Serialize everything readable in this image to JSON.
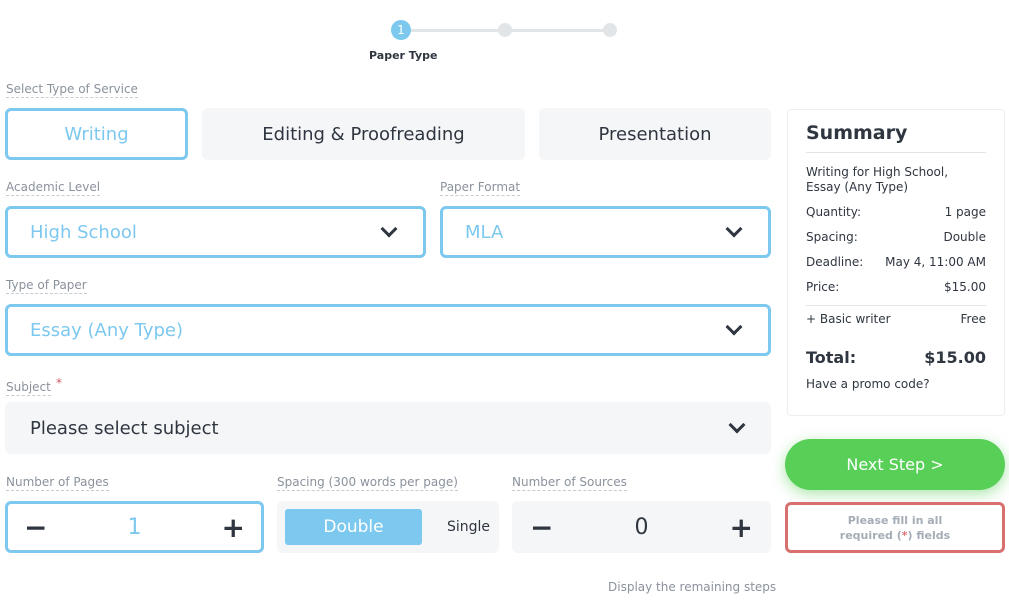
{
  "stepper": {
    "current": "1",
    "label": "Paper Type",
    "steps": 3
  },
  "service": {
    "label": "Select Type of Service",
    "options": [
      "Writing",
      "Editing & Proofreading",
      "Presentation"
    ],
    "selected": "Writing"
  },
  "academic_level": {
    "label": "Academic Level",
    "value": "High School"
  },
  "paper_format": {
    "label": "Paper Format",
    "value": "MLA"
  },
  "paper_type": {
    "label": "Type of Paper",
    "value": "Essay (Any Type)"
  },
  "subject": {
    "label": "Subject",
    "required": "*",
    "placeholder": "Please select subject"
  },
  "pages": {
    "label": "Number of Pages",
    "value": "1",
    "minus": "−",
    "plus": "+"
  },
  "spacing": {
    "label": "Spacing (300 words per page)",
    "options": [
      "Double",
      "Single"
    ],
    "selected": "Double"
  },
  "sources": {
    "label": "Number of Sources",
    "value": "0",
    "minus": "−",
    "plus": "+"
  },
  "summary": {
    "title": "Summary",
    "description": "Writing for High School, Essay (Any Type)",
    "rows": [
      {
        "k": "Quantity:",
        "v": "1 page"
      },
      {
        "k": "Spacing:",
        "v": "Double"
      },
      {
        "k": "Deadline:",
        "v": "May 4, 11:00 AM"
      },
      {
        "k": "Price:",
        "v": "$15.00"
      }
    ],
    "extra": {
      "k": "+ Basic writer",
      "v": "Free"
    },
    "total_label": "Total:",
    "total": "$15.00",
    "promo": "Have a promo code?"
  },
  "next_button": "Next Step >",
  "warning": {
    "line1": "Please fill in all",
    "pre": "required (",
    "star": "*",
    "post": ") fields"
  },
  "remaining_link": "Display the remaining steps",
  "colors": {
    "accent": "#7cc8ee",
    "green": "#58d058",
    "error": "#d87070"
  }
}
